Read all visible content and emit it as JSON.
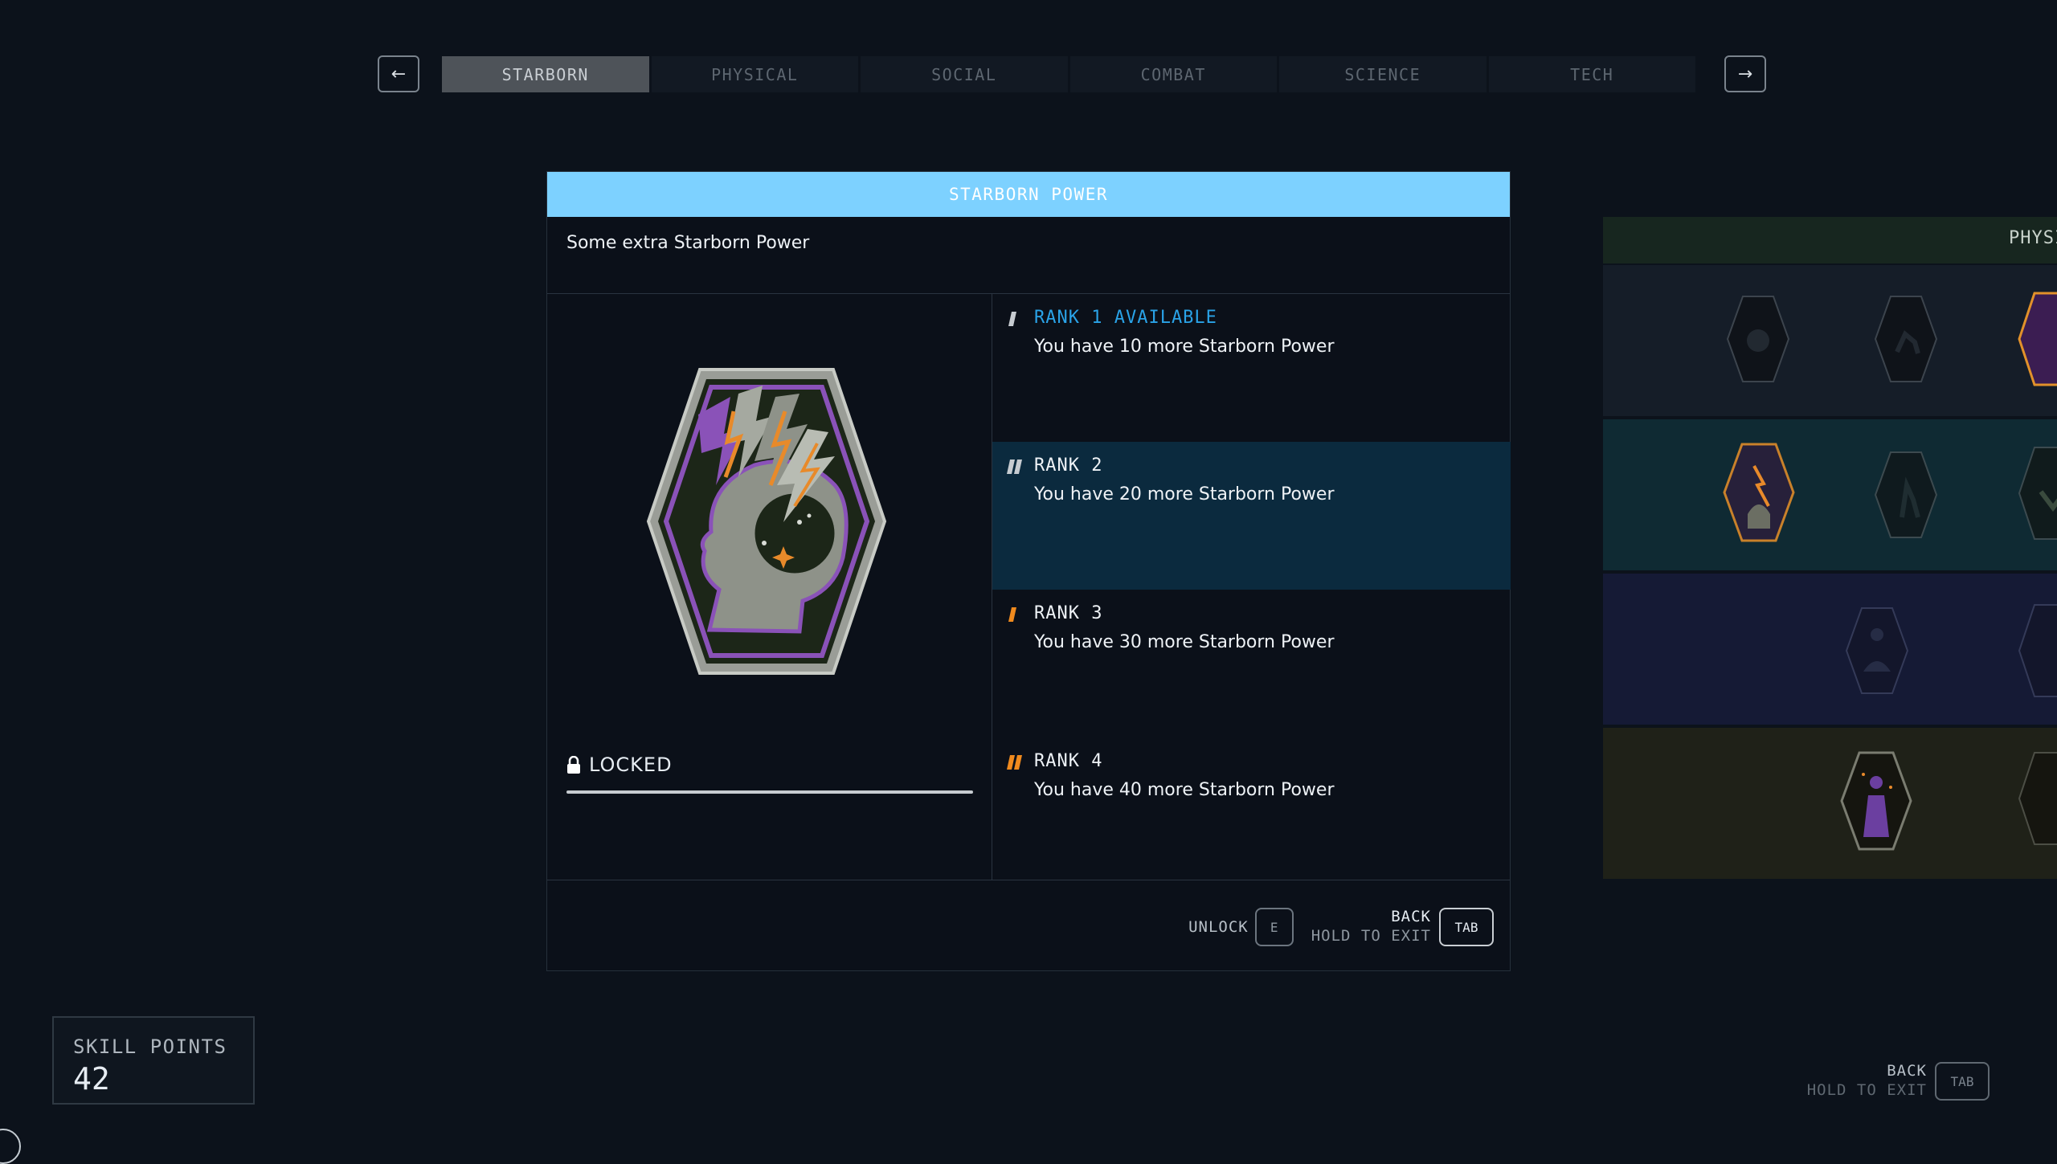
{
  "nav": {
    "prev_icon": "←",
    "next_icon": "→",
    "tabs": [
      "STARBORN",
      "PHYSICAL",
      "SOCIAL",
      "COMBAT",
      "SCIENCE",
      "TECH"
    ],
    "active_tab": "STARBORN"
  },
  "skill": {
    "title": "STARBORN POWER",
    "description": "Some extra Starborn Power",
    "status": "LOCKED",
    "ranks": [
      {
        "title": "RANK 1 AVAILABLE",
        "desc": "You have 10 more Starborn Power",
        "available": true
      },
      {
        "title": "RANK 2",
        "desc": "You have 20 more Starborn Power",
        "selected": true
      },
      {
        "title": "RANK 3",
        "desc": "You have 30 more Starborn Power"
      },
      {
        "title": "RANK 4",
        "desc": "You have 40 more Starborn Power"
      }
    ]
  },
  "actions": {
    "unlock_label": "UNLOCK",
    "unlock_key": "E",
    "back_label": "BACK",
    "hold_label": "HOLD TO EXIT",
    "back_key": "TAB"
  },
  "side_panel": {
    "header": "PHYSI"
  },
  "skill_points": {
    "label": "SKILL POINTS",
    "value": "42"
  },
  "corner": {
    "back_label": "BACK",
    "hold_label": "HOLD TO EXIT",
    "key": "TAB"
  },
  "colors": {
    "accent": "#7dd1ff",
    "available": "#2aa3e8",
    "rank_orange": "#f08a1e",
    "selected_row": "#0b2a3e"
  }
}
